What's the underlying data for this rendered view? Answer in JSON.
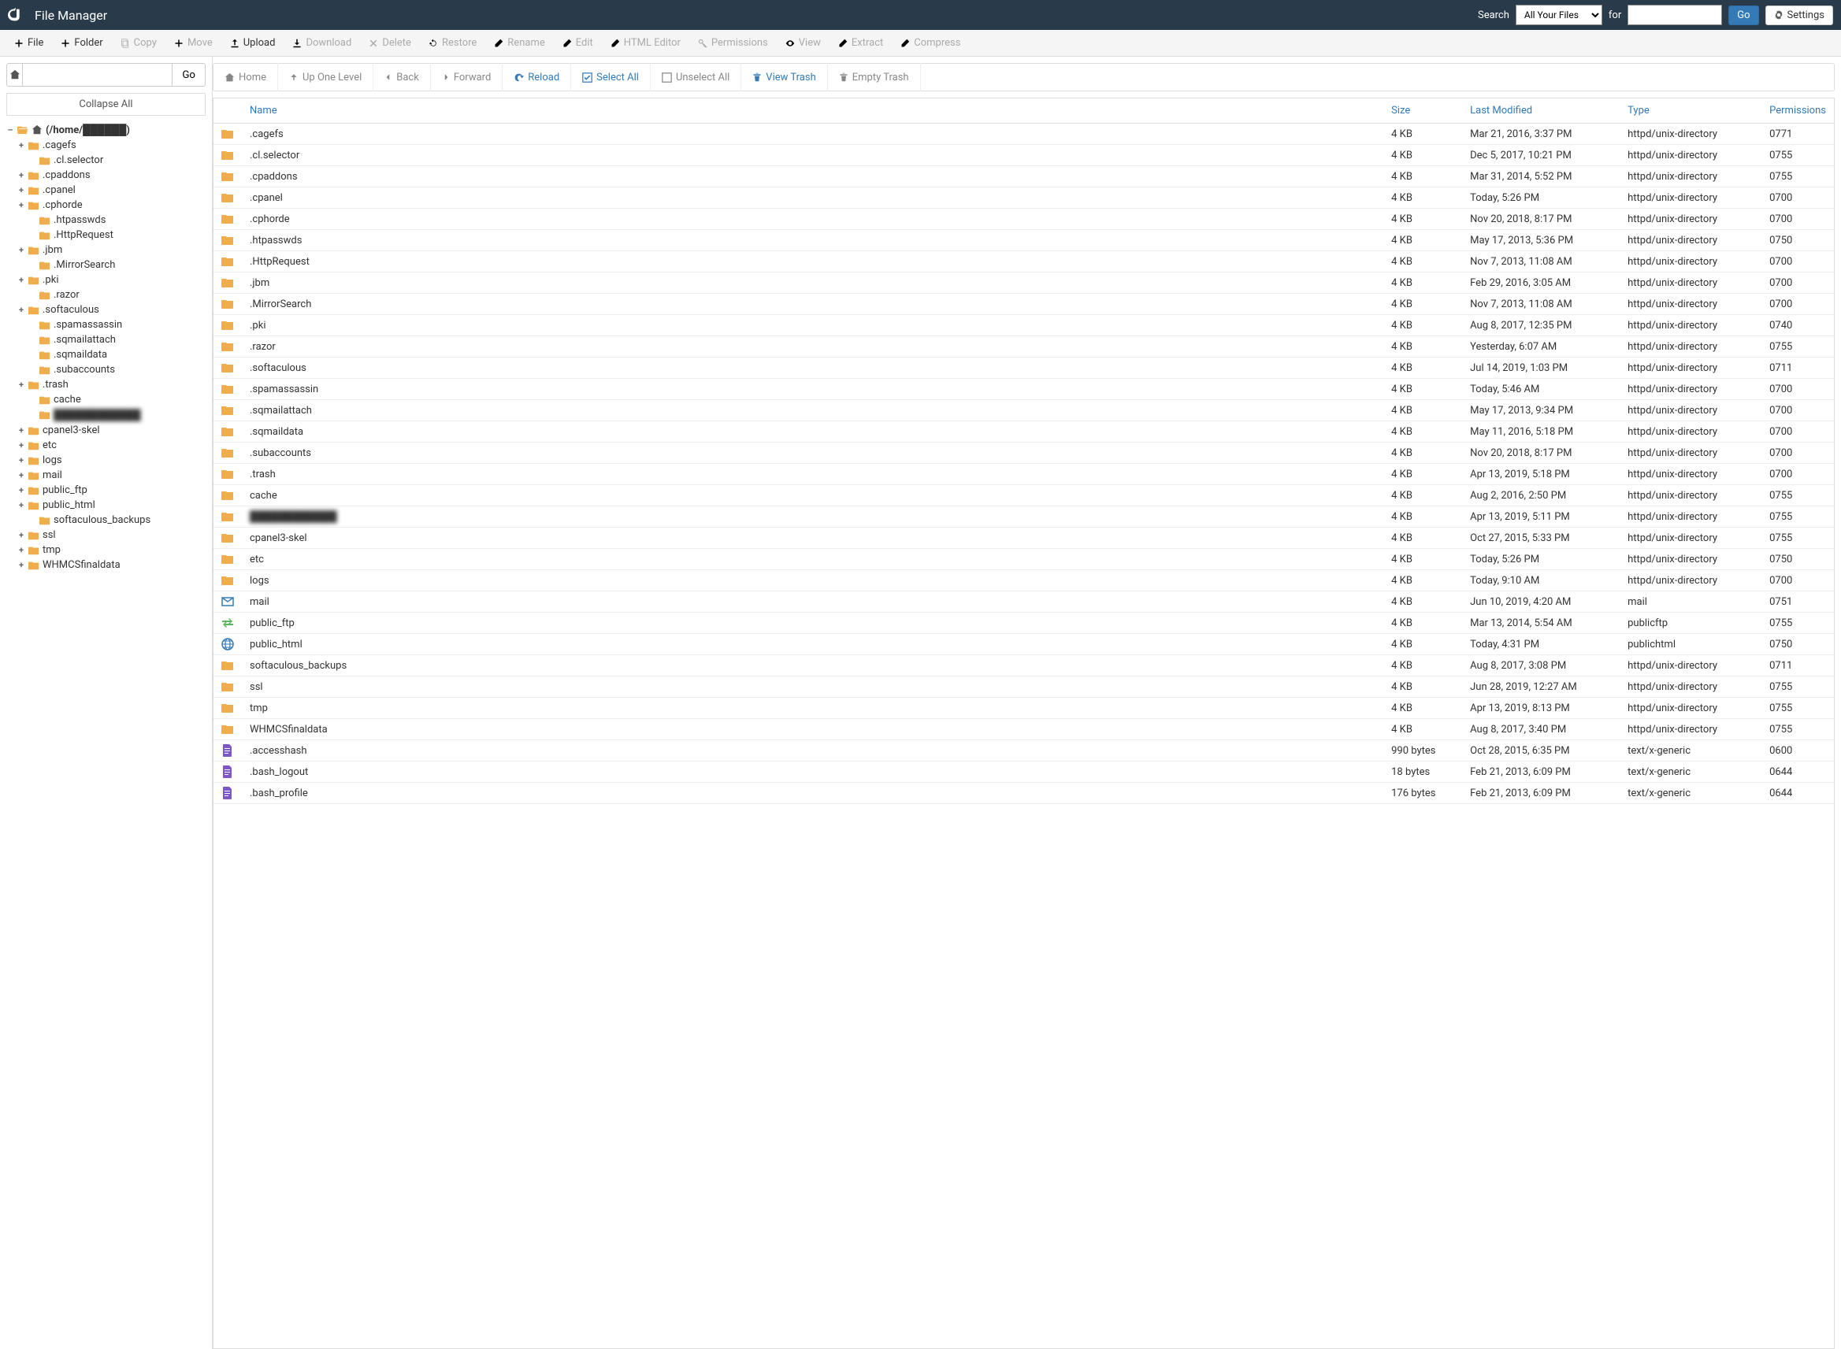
{
  "topbar": {
    "title": "File Manager",
    "search_label": "Search",
    "for_label": "for",
    "search_scope": "All Your Files",
    "go": "Go",
    "settings": "Settings"
  },
  "actions": {
    "file": "File",
    "folder": "Folder",
    "copy": "Copy",
    "move": "Move",
    "upload": "Upload",
    "download": "Download",
    "delete": "Delete",
    "restore": "Restore",
    "rename": "Rename",
    "edit": "Edit",
    "html_editor": "HTML Editor",
    "permissions": "Permissions",
    "view": "View",
    "extract": "Extract",
    "compress": "Compress"
  },
  "sidebar": {
    "go": "Go",
    "collapse": "Collapse All",
    "root_label": "(/home/██████)"
  },
  "tree": [
    {
      "t": "+",
      "l": ".cagefs",
      "d": 1
    },
    {
      "t": "",
      "l": ".cl.selector",
      "d": 2
    },
    {
      "t": "+",
      "l": ".cpaddons",
      "d": 1
    },
    {
      "t": "+",
      "l": ".cpanel",
      "d": 1
    },
    {
      "t": "+",
      "l": ".cphorde",
      "d": 1
    },
    {
      "t": "",
      "l": ".htpasswds",
      "d": 2
    },
    {
      "t": "",
      "l": ".HttpRequest",
      "d": 2
    },
    {
      "t": "+",
      "l": ".jbm",
      "d": 1
    },
    {
      "t": "",
      "l": ".MirrorSearch",
      "d": 2
    },
    {
      "t": "+",
      "l": ".pki",
      "d": 1
    },
    {
      "t": "",
      "l": ".razor",
      "d": 2
    },
    {
      "t": "+",
      "l": ".softaculous",
      "d": 1
    },
    {
      "t": "",
      "l": ".spamassassin",
      "d": 2
    },
    {
      "t": "",
      "l": ".sqmailattach",
      "d": 2
    },
    {
      "t": "",
      "l": ".sqmaildata",
      "d": 2
    },
    {
      "t": "",
      "l": ".subaccounts",
      "d": 2
    },
    {
      "t": "+",
      "l": ".trash",
      "d": 1
    },
    {
      "t": "",
      "l": "cache",
      "d": 2
    },
    {
      "t": "",
      "l": "████████████",
      "d": 2,
      "blur": true
    },
    {
      "t": "+",
      "l": "cpanel3-skel",
      "d": 1
    },
    {
      "t": "+",
      "l": "etc",
      "d": 1
    },
    {
      "t": "+",
      "l": "logs",
      "d": 1
    },
    {
      "t": "+",
      "l": "mail",
      "d": 1
    },
    {
      "t": "+",
      "l": "public_ftp",
      "d": 1
    },
    {
      "t": "+",
      "l": "public_html",
      "d": 1
    },
    {
      "t": "",
      "l": "softaculous_backups",
      "d": 2
    },
    {
      "t": "+",
      "l": "ssl",
      "d": 1
    },
    {
      "t": "+",
      "l": "tmp",
      "d": 1
    },
    {
      "t": "+",
      "l": "WHMCSfinaldata",
      "d": 1
    }
  ],
  "toolbar2": {
    "home": "Home",
    "up": "Up One Level",
    "back": "Back",
    "forward": "Forward",
    "reload": "Reload",
    "select_all": "Select All",
    "unselect_all": "Unselect All",
    "view_trash": "View Trash",
    "empty_trash": "Empty Trash"
  },
  "columns": {
    "name": "Name",
    "size": "Size",
    "modified": "Last Modified",
    "type": "Type",
    "perm": "Permissions"
  },
  "rows": [
    {
      "i": "folder",
      "n": ".cagefs",
      "s": "4 KB",
      "m": "Mar 21, 2016, 3:37 PM",
      "t": "httpd/unix-directory",
      "p": "0771"
    },
    {
      "i": "folder",
      "n": ".cl.selector",
      "s": "4 KB",
      "m": "Dec 5, 2017, 10:21 PM",
      "t": "httpd/unix-directory",
      "p": "0755"
    },
    {
      "i": "folder",
      "n": ".cpaddons",
      "s": "4 KB",
      "m": "Mar 31, 2014, 5:52 PM",
      "t": "httpd/unix-directory",
      "p": "0755"
    },
    {
      "i": "folder",
      "n": ".cpanel",
      "s": "4 KB",
      "m": "Today, 5:26 PM",
      "t": "httpd/unix-directory",
      "p": "0700"
    },
    {
      "i": "folder",
      "n": ".cphorde",
      "s": "4 KB",
      "m": "Nov 20, 2018, 8:17 PM",
      "t": "httpd/unix-directory",
      "p": "0700"
    },
    {
      "i": "folder",
      "n": ".htpasswds",
      "s": "4 KB",
      "m": "May 17, 2013, 5:36 PM",
      "t": "httpd/unix-directory",
      "p": "0750"
    },
    {
      "i": "folder",
      "n": ".HttpRequest",
      "s": "4 KB",
      "m": "Nov 7, 2013, 11:08 AM",
      "t": "httpd/unix-directory",
      "p": "0700"
    },
    {
      "i": "folder",
      "n": ".jbm",
      "s": "4 KB",
      "m": "Feb 29, 2016, 3:05 AM",
      "t": "httpd/unix-directory",
      "p": "0700"
    },
    {
      "i": "folder",
      "n": ".MirrorSearch",
      "s": "4 KB",
      "m": "Nov 7, 2013, 11:08 AM",
      "t": "httpd/unix-directory",
      "p": "0700"
    },
    {
      "i": "folder",
      "n": ".pki",
      "s": "4 KB",
      "m": "Aug 8, 2017, 12:35 PM",
      "t": "httpd/unix-directory",
      "p": "0740"
    },
    {
      "i": "folder",
      "n": ".razor",
      "s": "4 KB",
      "m": "Yesterday, 6:07 AM",
      "t": "httpd/unix-directory",
      "p": "0755"
    },
    {
      "i": "folder",
      "n": ".softaculous",
      "s": "4 KB",
      "m": "Jul 14, 2019, 1:03 PM",
      "t": "httpd/unix-directory",
      "p": "0711"
    },
    {
      "i": "folder",
      "n": ".spamassassin",
      "s": "4 KB",
      "m": "Today, 5:46 AM",
      "t": "httpd/unix-directory",
      "p": "0700"
    },
    {
      "i": "folder",
      "n": ".sqmailattach",
      "s": "4 KB",
      "m": "May 17, 2013, 9:34 PM",
      "t": "httpd/unix-directory",
      "p": "0700"
    },
    {
      "i": "folder",
      "n": ".sqmaildata",
      "s": "4 KB",
      "m": "May 11, 2016, 5:18 PM",
      "t": "httpd/unix-directory",
      "p": "0700"
    },
    {
      "i": "folder",
      "n": ".subaccounts",
      "s": "4 KB",
      "m": "Nov 20, 2018, 8:17 PM",
      "t": "httpd/unix-directory",
      "p": "0700"
    },
    {
      "i": "folder",
      "n": ".trash",
      "s": "4 KB",
      "m": "Apr 13, 2019, 5:18 PM",
      "t": "httpd/unix-directory",
      "p": "0700"
    },
    {
      "i": "folder",
      "n": "cache",
      "s": "4 KB",
      "m": "Aug 2, 2016, 2:50 PM",
      "t": "httpd/unix-directory",
      "p": "0755"
    },
    {
      "i": "folder",
      "n": "████████████",
      "s": "4 KB",
      "m": "Apr 13, 2019, 5:11 PM",
      "t": "httpd/unix-directory",
      "p": "0755",
      "blur": true
    },
    {
      "i": "folder",
      "n": "cpanel3-skel",
      "s": "4 KB",
      "m": "Oct 27, 2015, 5:33 PM",
      "t": "httpd/unix-directory",
      "p": "0755"
    },
    {
      "i": "folder",
      "n": "etc",
      "s": "4 KB",
      "m": "Today, 5:26 PM",
      "t": "httpd/unix-directory",
      "p": "0750"
    },
    {
      "i": "folder",
      "n": "logs",
      "s": "4 KB",
      "m": "Today, 9:10 AM",
      "t": "httpd/unix-directory",
      "p": "0700"
    },
    {
      "i": "mail",
      "n": "mail",
      "s": "4 KB",
      "m": "Jun 10, 2019, 4:20 AM",
      "t": "mail",
      "p": "0751"
    },
    {
      "i": "ftp",
      "n": "public_ftp",
      "s": "4 KB",
      "m": "Mar 13, 2014, 5:54 AM",
      "t": "publicftp",
      "p": "0755"
    },
    {
      "i": "globe",
      "n": "public_html",
      "s": "4 KB",
      "m": "Today, 4:31 PM",
      "t": "publichtml",
      "p": "0750"
    },
    {
      "i": "folder",
      "n": "softaculous_backups",
      "s": "4 KB",
      "m": "Aug 8, 2017, 3:08 PM",
      "t": "httpd/unix-directory",
      "p": "0711"
    },
    {
      "i": "folder",
      "n": "ssl",
      "s": "4 KB",
      "m": "Jun 28, 2019, 12:27 AM",
      "t": "httpd/unix-directory",
      "p": "0755"
    },
    {
      "i": "folder",
      "n": "tmp",
      "s": "4 KB",
      "m": "Apr 13, 2019, 8:13 PM",
      "t": "httpd/unix-directory",
      "p": "0755"
    },
    {
      "i": "folder",
      "n": "WHMCSfinaldata",
      "s": "4 KB",
      "m": "Aug 8, 2017, 3:40 PM",
      "t": "httpd/unix-directory",
      "p": "0755"
    },
    {
      "i": "file",
      "n": ".accesshash",
      "s": "990 bytes",
      "m": "Oct 28, 2015, 6:35 PM",
      "t": "text/x-generic",
      "p": "0600"
    },
    {
      "i": "file",
      "n": ".bash_logout",
      "s": "18 bytes",
      "m": "Feb 21, 2013, 6:09 PM",
      "t": "text/x-generic",
      "p": "0644"
    },
    {
      "i": "file",
      "n": ".bash_profile",
      "s": "176 bytes",
      "m": "Feb 21, 2013, 6:09 PM",
      "t": "text/x-generic",
      "p": "0644"
    }
  ]
}
